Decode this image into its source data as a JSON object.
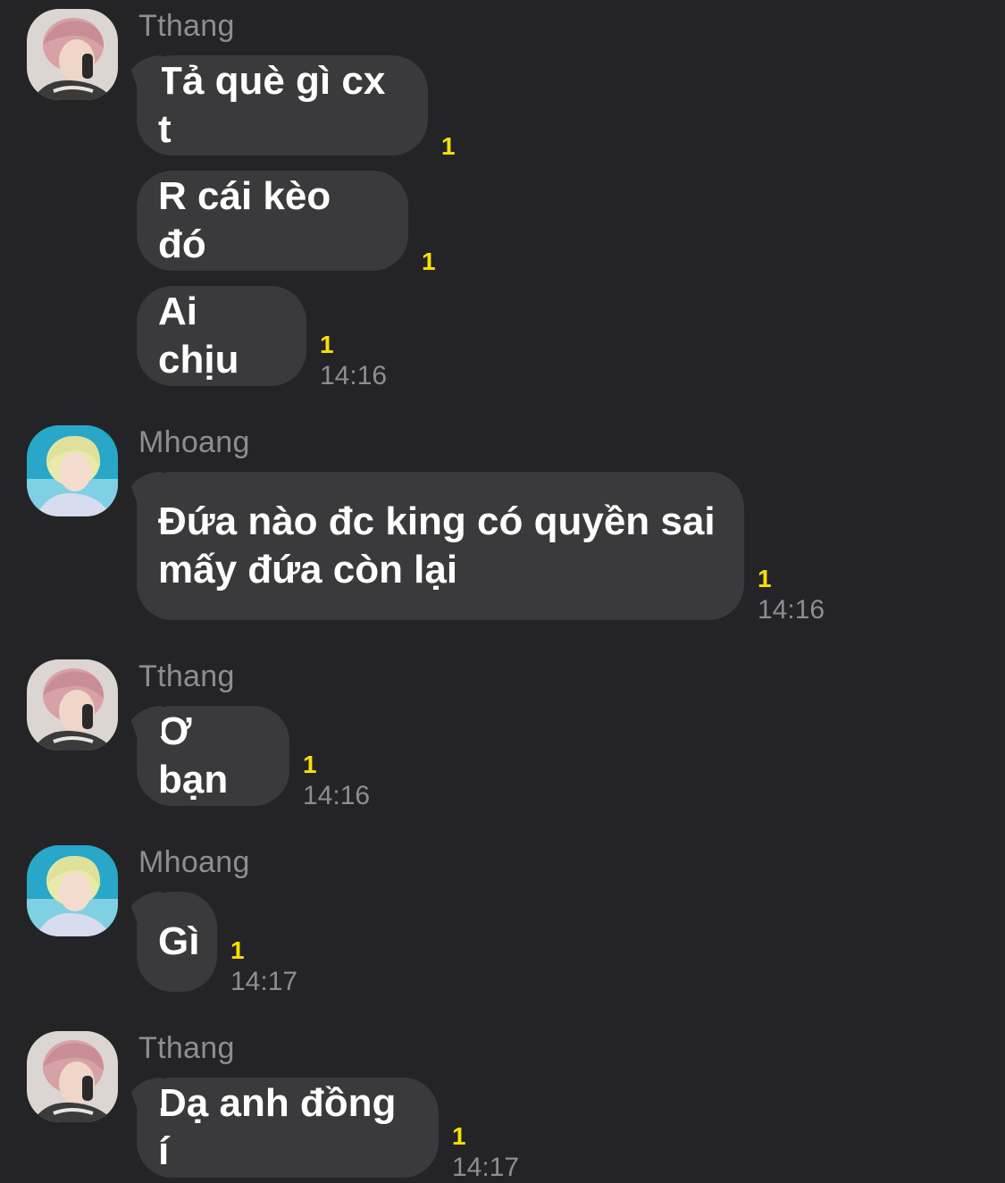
{
  "messages": [
    {
      "sender": "Tthang",
      "avatar": "pink-hair-avatar",
      "bubbles": [
        {
          "text": "Tả què gì cx t",
          "unread": "1"
        },
        {
          "text": "R cái kèo đó",
          "unread": "1"
        },
        {
          "text": "Ai chịu",
          "unread": "1",
          "time": "14:16"
        }
      ]
    },
    {
      "sender": "Mhoang",
      "avatar": "blonde-hair-avatar",
      "bubbles": [
        {
          "text": "Đứa nào đc king có quyền sai mấy đứa còn lại",
          "unread": "1",
          "time": "14:16"
        }
      ]
    },
    {
      "sender": "Tthang",
      "avatar": "pink-hair-avatar",
      "bubbles": [
        {
          "text": "Ơ bạn",
          "unread": "1",
          "time": "14:16"
        }
      ]
    },
    {
      "sender": "Mhoang",
      "avatar": "blonde-hair-avatar",
      "bubbles": [
        {
          "text": "Gì",
          "unread": "1",
          "time": "14:17"
        }
      ]
    },
    {
      "sender": "Tthang",
      "avatar": "pink-hair-avatar",
      "bubbles": [
        {
          "text": "Dạ anh đồng í",
          "unread": "1",
          "time": "14:17"
        }
      ]
    }
  ],
  "colors": {
    "background": "#242426",
    "bubble": "#3a3a3d",
    "unread": "#f9e000",
    "meta": "#8d8d93"
  }
}
